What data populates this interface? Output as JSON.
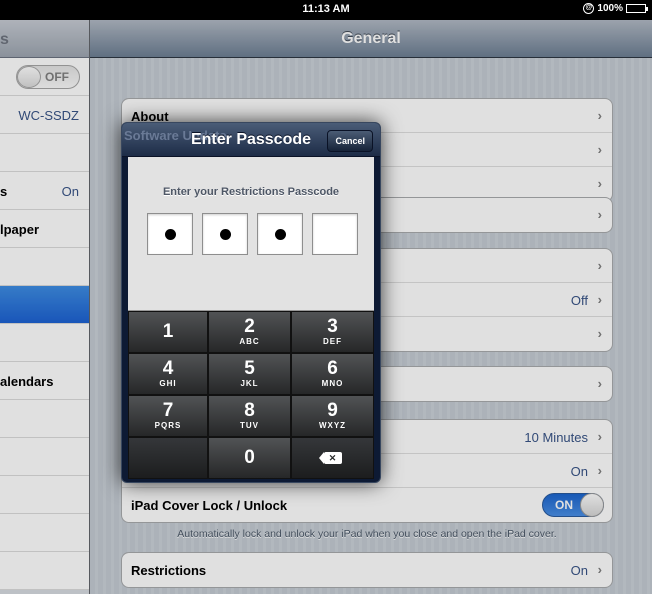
{
  "status_bar": {
    "time": "11:13 AM",
    "lock_glyph": "@",
    "battery": "100%"
  },
  "master": {
    "title": "s",
    "items": [
      {
        "label": "",
        "toggle": "OFF"
      },
      {
        "label": "",
        "value": "WC-SSDZ"
      },
      {
        "label": ""
      },
      {
        "label": "s",
        "value": "On"
      },
      {
        "label": "lpaper"
      },
      {
        "label": ""
      },
      {
        "label": "",
        "selected": true
      },
      {
        "label": ""
      },
      {
        "label": "alendars"
      }
    ]
  },
  "detail": {
    "title": "General",
    "group1": [
      {
        "label": "About"
      },
      {
        "label": "Software Update"
      },
      {
        "label": ""
      }
    ],
    "group2": [
      {
        "label": ""
      }
    ],
    "group3": [
      {
        "label": ""
      },
      {
        "label": "",
        "value": "Off"
      },
      {
        "label": ""
      }
    ],
    "group4": [
      {
        "label": ""
      }
    ],
    "group5": [
      {
        "label": "",
        "value": "10 Minutes"
      },
      {
        "label": "",
        "value": "On"
      },
      {
        "label": "iPad Cover Lock / Unlock",
        "switch": "ON"
      }
    ],
    "cover_footnote": "Automatically lock and unlock your iPad when you close and open the iPad cover.",
    "group6": [
      {
        "label": "Restrictions",
        "value": "On"
      }
    ]
  },
  "passcode_sheet": {
    "title": "Enter Passcode",
    "cancel_label": "Cancel",
    "prompt": "Enter your Restrictions Passcode",
    "entered_digits": 3,
    "total_digits": 4,
    "keys": [
      {
        "num": "1",
        "letters": ""
      },
      {
        "num": "2",
        "letters": "ABC"
      },
      {
        "num": "3",
        "letters": "DEF"
      },
      {
        "num": "4",
        "letters": "GHI"
      },
      {
        "num": "5",
        "letters": "JKL"
      },
      {
        "num": "6",
        "letters": "MNO"
      },
      {
        "num": "7",
        "letters": "PQRS"
      },
      {
        "num": "8",
        "letters": "TUV"
      },
      {
        "num": "9",
        "letters": "WXYZ"
      },
      {
        "num": "",
        "letters": ""
      },
      {
        "num": "0",
        "letters": ""
      },
      {
        "num": "delete-key-icon",
        "letters": ""
      }
    ]
  },
  "colors": {
    "selection": "#1d62d3",
    "switch_on": "#1c66cf",
    "value_text": "#385487"
  }
}
